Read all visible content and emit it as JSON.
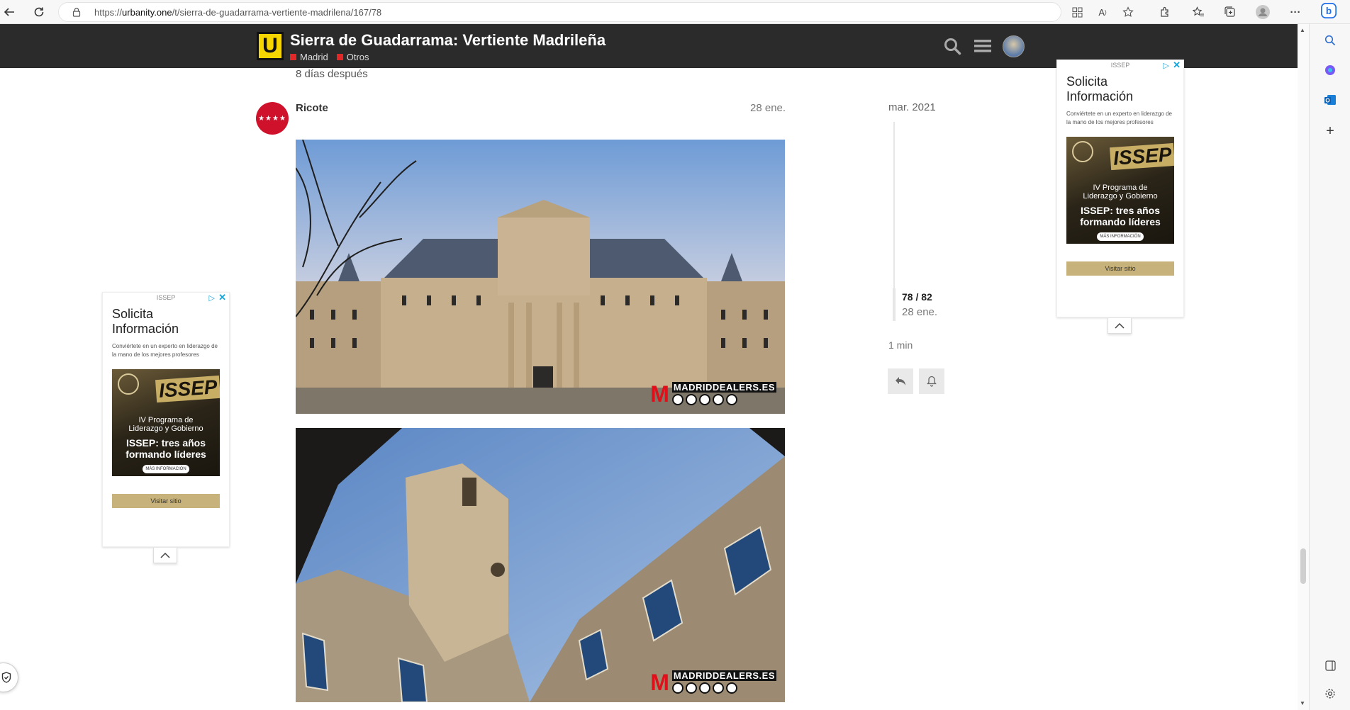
{
  "browser": {
    "url_prefix": "https://",
    "url_domain": "urbanity.one",
    "url_path": "/t/sierra-de-guadarrama-vertiente-madrilena/167/78"
  },
  "site": {
    "logo_letter": "U",
    "topic_title": "Sierra de Guadarrama: Vertiente Madrileña",
    "categories": [
      {
        "label": "Madrid",
        "color": "#e02828"
      },
      {
        "label": "Otros",
        "color": "#e02828"
      }
    ]
  },
  "post": {
    "time_gap": "8 días después",
    "username": "Ricote",
    "date": "28 ene.",
    "watermark_letter": "M",
    "watermark_text": "MADRIDDEALERS.ES"
  },
  "timeline": {
    "start_label": "mar. 2021",
    "count": "78 / 82",
    "current_date": "28 ene.",
    "end_label": "1 min"
  },
  "ad": {
    "advertiser": "ISSEP",
    "title_line1": "Solicita",
    "title_line2": "Información",
    "description": "Conviértete en un experto en liderazgo de la mano de los mejores profesores",
    "image_brand": "ISSEP",
    "image_program_line1": "IV Programa de",
    "image_program_line2": "Liderazgo y Gobierno",
    "image_headline_line1": "ISSEP: tres años",
    "image_headline_line2": "formando líderes",
    "image_more": "MÁS INFORMACIÓN",
    "button_label": "Visitar sitio"
  },
  "colors": {
    "header_bg": "#2b2b2b",
    "logo_yellow": "#f6d600",
    "avatar_red": "#d0112b",
    "ad_accent": "#1aa3d6",
    "ad_button": "#c6b27a"
  }
}
